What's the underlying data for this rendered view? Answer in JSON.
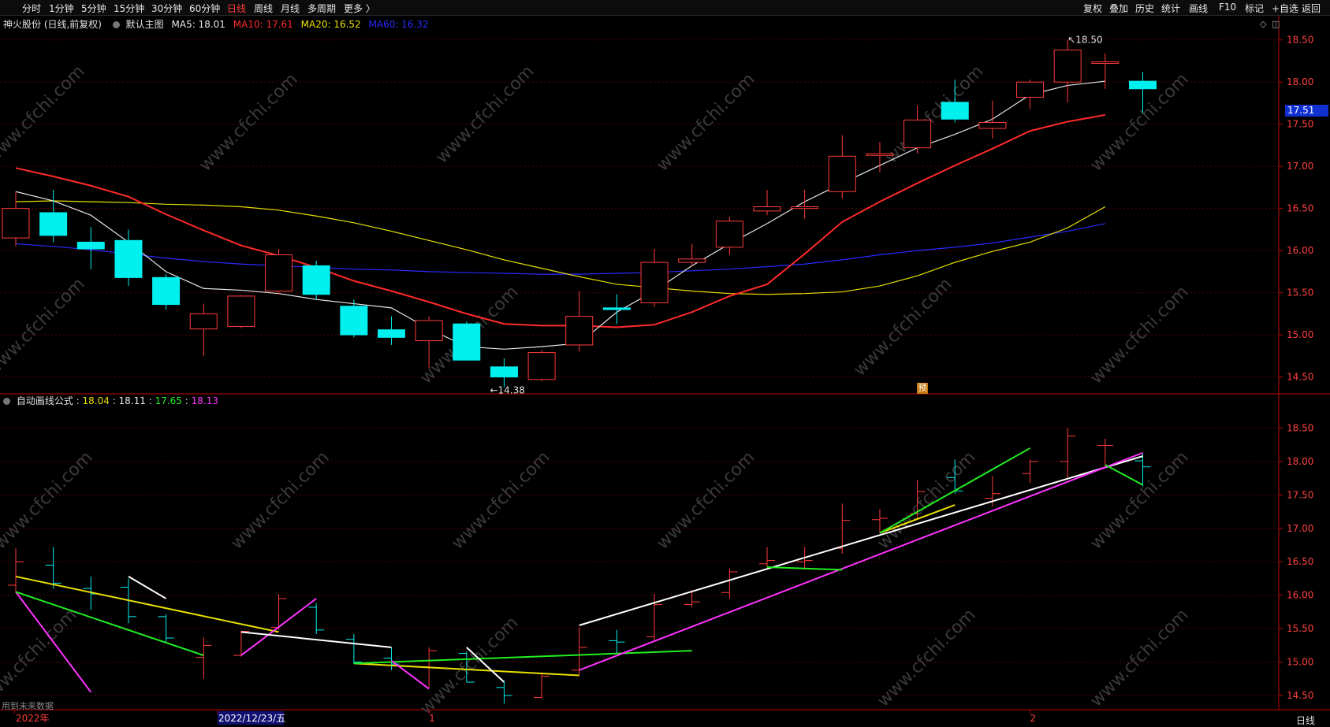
{
  "toolbar": {
    "left": [
      "分时",
      "1分钟",
      "5分钟",
      "15分钟",
      "30分钟",
      "60分钟",
      "日线",
      "周线",
      "月线",
      "多周期",
      "更多 〉"
    ],
    "active": "日线",
    "right": [
      "复权",
      "叠加",
      "历史",
      "统计",
      "画线",
      "F10",
      "标记",
      "+自选",
      "返回"
    ]
  },
  "main_title": {
    "stock": "神火股份 (日线,前复权)",
    "template": "默认主图",
    "ma": [
      {
        "label": "MA5: 18.01",
        "color": "#e6e6e6"
      },
      {
        "label": "MA10: 17.61",
        "color": "#ff2a2a"
      },
      {
        "label": "MA20: 16.52",
        "color": "#e8e000"
      },
      {
        "label": "MA60: 16.32",
        "color": "#2a2aff"
      }
    ]
  },
  "indicator_title": {
    "name": "自动画线公式",
    "values": [
      {
        "label": "18.04",
        "color": "#e8e000"
      },
      {
        "label": "18.11",
        "color": "#e6e6e6"
      },
      {
        "label": "17.65",
        "color": "#22ee22"
      },
      {
        "label": "18.13",
        "color": "#ff33ff"
      }
    ]
  },
  "price_tag": "17.51",
  "badge": "预",
  "note": "用到未来数据",
  "period_tag": "日线",
  "colors": {
    "up": "#ff3b3b",
    "down": "#00f0f0",
    "ma5": "#e6e6e6",
    "ma10": "#ff2a2a",
    "ma20": "#e8e000",
    "ma60": "#2a2aff",
    "white": "#ffffff",
    "green": "#22ee22",
    "magenta": "#ff33ff",
    "yellow": "#e8e000"
  },
  "chart_data": [
    {
      "type": "candlestick",
      "name": "main",
      "ylim": [
        14.3,
        18.6
      ],
      "yticks": [
        14.5,
        15.0,
        15.5,
        16.0,
        16.5,
        17.0,
        17.5,
        18.0,
        18.5
      ],
      "candles": [
        {
          "o": 16.15,
          "h": 16.7,
          "l": 16.05,
          "c": 16.5
        },
        {
          "o": 16.45,
          "h": 16.72,
          "l": 16.1,
          "c": 16.18
        },
        {
          "o": 16.1,
          "h": 16.28,
          "l": 15.78,
          "c": 16.02
        },
        {
          "o": 16.12,
          "h": 16.25,
          "l": 15.58,
          "c": 15.68
        },
        {
          "o": 15.68,
          "h": 15.72,
          "l": 15.3,
          "c": 15.36
        },
        {
          "o": 15.07,
          "h": 15.37,
          "l": 14.75,
          "c": 15.25
        },
        {
          "o": 15.1,
          "h": 15.47,
          "l": 15.08,
          "c": 15.46
        },
        {
          "o": 15.52,
          "h": 16.02,
          "l": 15.48,
          "c": 15.95
        },
        {
          "o": 15.82,
          "h": 15.88,
          "l": 15.42,
          "c": 15.48
        },
        {
          "o": 15.34,
          "h": 15.42,
          "l": 14.97,
          "c": 15.0
        },
        {
          "o": 15.06,
          "h": 15.22,
          "l": 14.88,
          "c": 14.97
        },
        {
          "o": 14.93,
          "h": 15.22,
          "l": 14.6,
          "c": 15.17
        },
        {
          "o": 15.13,
          "h": 15.16,
          "l": 14.7,
          "c": 14.7
        },
        {
          "o": 14.62,
          "h": 14.72,
          "l": 14.38,
          "c": 14.5
        },
        {
          "o": 14.47,
          "h": 14.82,
          "l": 14.45,
          "c": 14.79
        },
        {
          "o": 14.88,
          "h": 15.52,
          "l": 14.8,
          "c": 15.22
        },
        {
          "o": 15.32,
          "h": 15.48,
          "l": 15.13,
          "c": 15.3
        },
        {
          "o": 15.38,
          "h": 16.02,
          "l": 15.33,
          "c": 15.86
        },
        {
          "o": 15.86,
          "h": 16.08,
          "l": 15.82,
          "c": 15.9
        },
        {
          "o": 16.04,
          "h": 16.4,
          "l": 15.95,
          "c": 16.35
        },
        {
          "o": 16.47,
          "h": 16.72,
          "l": 16.42,
          "c": 16.52
        },
        {
          "o": 16.5,
          "h": 16.72,
          "l": 16.38,
          "c": 16.52
        },
        {
          "o": 16.7,
          "h": 17.37,
          "l": 16.62,
          "c": 17.12
        },
        {
          "o": 17.13,
          "h": 17.29,
          "l": 16.93,
          "c": 17.15
        },
        {
          "o": 17.22,
          "h": 17.72,
          "l": 17.15,
          "c": 17.55
        },
        {
          "o": 17.76,
          "h": 18.03,
          "l": 17.52,
          "c": 17.56
        },
        {
          "o": 17.45,
          "h": 17.78,
          "l": 17.33,
          "c": 17.52
        },
        {
          "o": 17.82,
          "h": 18.03,
          "l": 17.68,
          "c": 18.0
        },
        {
          "o": 18.0,
          "h": 18.5,
          "l": 17.76,
          "c": 18.38
        },
        {
          "o": 18.24,
          "h": 18.34,
          "l": 17.92,
          "c": 18.24
        },
        {
          "o": 18.01,
          "h": 18.12,
          "l": 17.63,
          "c": 17.92
        }
      ],
      "ma5": [
        16.7,
        16.59,
        16.42,
        16.1,
        15.75,
        15.55,
        15.53,
        15.49,
        15.42,
        15.37,
        15.32,
        15.07,
        14.86,
        14.83,
        14.86,
        14.9,
        15.27,
        15.52,
        15.82,
        16.08,
        16.32,
        16.58,
        16.8,
        17.01,
        17.22,
        17.38,
        17.56,
        17.85,
        17.96,
        18.01
      ],
      "ma10": [
        16.98,
        16.88,
        16.77,
        16.64,
        16.43,
        16.24,
        16.06,
        15.94,
        15.8,
        15.64,
        15.52,
        15.39,
        15.25,
        15.13,
        15.11,
        15.11,
        15.09,
        15.12,
        15.27,
        15.46,
        15.6,
        15.96,
        16.34,
        16.58,
        16.8,
        17.01,
        17.21,
        17.42,
        17.53,
        17.61
      ],
      "ma20": [
        16.58,
        16.59,
        16.58,
        16.57,
        16.55,
        16.54,
        16.52,
        16.48,
        16.41,
        16.33,
        16.23,
        16.12,
        16.01,
        15.89,
        15.79,
        15.69,
        15.6,
        15.56,
        15.52,
        15.49,
        15.48,
        15.49,
        15.51,
        15.58,
        15.7,
        15.86,
        15.99,
        16.1,
        16.27,
        16.52
      ],
      "ma60": [
        16.08,
        16.05,
        16.01,
        15.96,
        15.91,
        15.87,
        15.84,
        15.82,
        15.8,
        15.78,
        15.77,
        15.75,
        15.74,
        15.73,
        15.72,
        15.72,
        15.73,
        15.74,
        15.76,
        15.78,
        15.81,
        15.84,
        15.89,
        15.95,
        16.0,
        16.04,
        16.09,
        16.16,
        16.23,
        16.32
      ],
      "annotations": [
        {
          "label": "18.50",
          "bar": 28,
          "value": 18.5
        },
        {
          "label": "14.38",
          "bar": 13,
          "value": 14.38
        }
      ]
    },
    {
      "type": "line",
      "name": "自动画线公式",
      "ylim": [
        14.3,
        18.8
      ],
      "yticks": [
        14.5,
        15.0,
        15.5,
        16.0,
        16.5,
        17.0,
        17.5,
        18.0,
        18.5
      ],
      "bars": "same as main candles",
      "lines": [
        {
          "color": "magenta",
          "points": [
            [
              0,
              16.05
            ],
            [
              2,
              14.55
            ]
          ]
        },
        {
          "color": "green",
          "points": [
            [
              0,
              16.05
            ],
            [
              5,
              15.1
            ]
          ]
        },
        {
          "color": "yellow",
          "points": [
            [
              0,
              16.28
            ],
            [
              7,
              15.45
            ]
          ]
        },
        {
          "color": "white",
          "points": [
            [
              3,
              16.28
            ],
            [
              4,
              15.95
            ]
          ]
        },
        {
          "color": "magenta",
          "points": [
            [
              6,
              15.1
            ],
            [
              8,
              15.95
            ]
          ]
        },
        {
          "color": "white",
          "points": [
            [
              6,
              15.45
            ],
            [
              10,
              15.22
            ]
          ]
        },
        {
          "color": "yellow",
          "points": [
            [
              9,
              14.98
            ],
            [
              15,
              14.8
            ]
          ]
        },
        {
          "color": "green",
          "points": [
            [
              9,
              14.98
            ],
            [
              18,
              15.17
            ]
          ]
        },
        {
          "color": "magenta",
          "points": [
            [
              10,
              15.02
            ],
            [
              11,
              14.6
            ]
          ]
        },
        {
          "color": "white",
          "points": [
            [
              12,
              15.22
            ],
            [
              13,
              14.7
            ]
          ]
        },
        {
          "color": "white",
          "points": [
            [
              15,
              15.55
            ],
            [
              30,
              18.08
            ]
          ]
        },
        {
          "color": "magenta",
          "points": [
            [
              15,
              14.88
            ],
            [
              30,
              18.13
            ]
          ]
        },
        {
          "color": "green",
          "points": [
            [
              20,
              16.42
            ],
            [
              22,
              16.38
            ]
          ]
        },
        {
          "color": "yellow",
          "points": [
            [
              23,
              16.93
            ],
            [
              25,
              17.35
            ]
          ]
        },
        {
          "color": "green",
          "points": [
            [
              23,
              16.93
            ],
            [
              27,
              18.2
            ]
          ]
        },
        {
          "color": "green",
          "points": [
            [
              29,
              17.95
            ],
            [
              30,
              17.65
            ]
          ]
        }
      ]
    }
  ],
  "x_axis": [
    {
      "label": "2022年",
      "bar": 0,
      "color": "#ff3b3b",
      "highlight": false
    },
    {
      "label": "2022/12/23/五",
      "bar": 5,
      "color": "#ffffff",
      "highlight": true
    },
    {
      "label": "1",
      "bar": 11,
      "color": "#ff3b3b",
      "highlight": false
    },
    {
      "label": "2",
      "bar": 27,
      "color": "#ff3b3b",
      "highlight": false
    }
  ],
  "watermark": "www.cfchi.com"
}
